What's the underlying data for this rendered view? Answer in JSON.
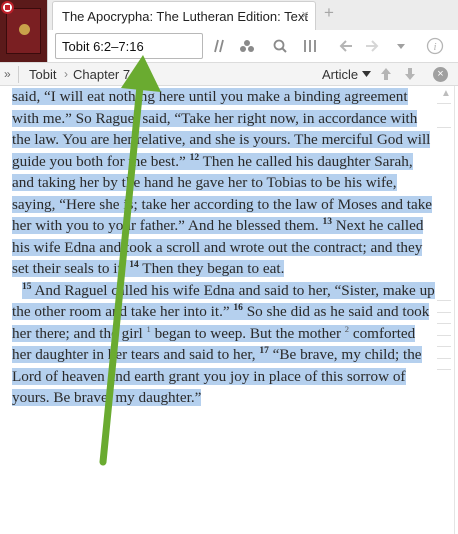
{
  "tab": {
    "title": "The Apocrypha: The Lutheran Edition: Text",
    "close_glyph": "×",
    "new_tab_glyph": "+"
  },
  "toolbar": {
    "reference_value": "Tobit 6:2–7:16"
  },
  "locbar": {
    "crumbs": [
      "Tobit",
      "Chapter 7"
    ],
    "crumb_separator": "›",
    "article_label": "Article",
    "close_glyph": "×"
  },
  "icons": [
    "logos-logo-icon",
    "book-cover-icon",
    "parallel-resources-icon",
    "visual-filters-icon",
    "search-icon",
    "columns-icon",
    "back-arrow-icon",
    "forward-arrow-icon",
    "history-dropdown-icon",
    "info-icon",
    "expand-panel-icon",
    "chevron-down-icon",
    "scroll-up-icon",
    "scroll-down-icon",
    "close-location-icon"
  ],
  "colors": {
    "highlight": "#b5d0ee",
    "annotation_arrow": "#6aab30",
    "logo_red": "#c0202a"
  },
  "text": {
    "p1": {
      "a": "said, “I will eat nothing here until you make a binding agreement with me.” So Raguel said, “Take her right now, in accordance with the law. You are her relative, and she is yours. The merciful God will guide you both for the best.” ",
      "v12": "12",
      "b": " Then he called his daughter Sarah, and taking her by the hand he gave her to Tobias to be his wife, saying, “Here she is; take her according to the law of Moses and take her with you to your father.” And he blessed them. ",
      "v13": "13",
      "c": " Next he called his wife Edna and took a scroll and wrote out the contract; and they set their seals to it. ",
      "v14": "14",
      "d": " Then they began to eat."
    },
    "p2": {
      "v15": "15",
      "a": " And Raguel called his wife Edna and said to her, “Sister, make up the other room and take her into it.” ",
      "v16": "16",
      "b": " So she did as he said and took her there; and the girl ",
      "n1": "1",
      "c": " began to weep. But the mother ",
      "n2": "2",
      "d": " comforted her daughter in her tears and said to her, ",
      "v17": "17",
      "e": " “Be brave, my child; the Lord of heaven and earth grant you joy in place of this sorrow of yours. Be brave, my daughter.”"
    }
  }
}
